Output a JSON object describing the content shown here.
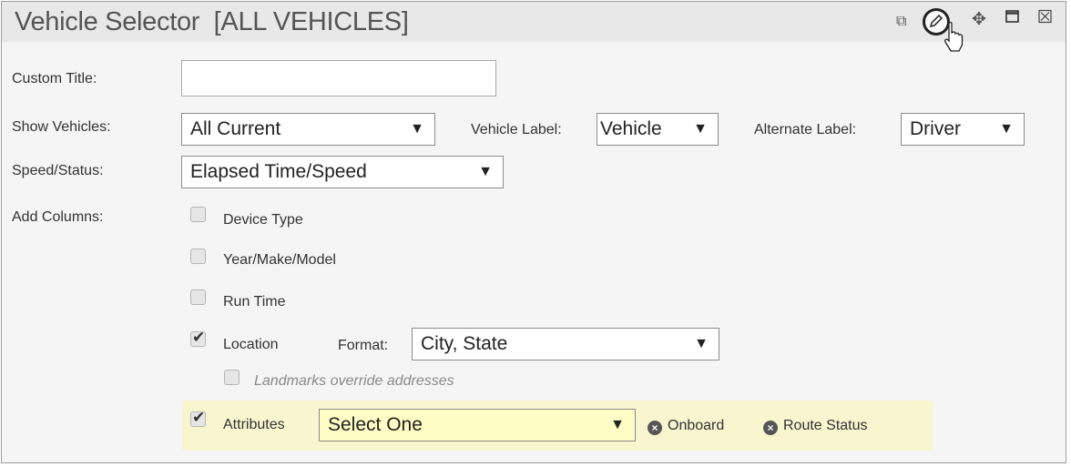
{
  "window": {
    "title": "Vehicle Selector  [ALL VEHICLES]",
    "controls": [
      "copy-icon",
      "edit-icon",
      "move-icon",
      "maximize-icon",
      "close-icon"
    ]
  },
  "form": {
    "custom_title": {
      "label": "Custom Title:",
      "value": ""
    },
    "show_vehicles": {
      "label": "Show Vehicles:",
      "value": "All Current"
    },
    "vehicle_label": {
      "label": "Vehicle Label:",
      "value": "Vehicle"
    },
    "alternate_label": {
      "label": "Alternate Label:",
      "value": "Driver"
    },
    "speed_status": {
      "label": "Speed/Status:",
      "value": "Elapsed Time/Speed"
    },
    "add_columns": {
      "label": "Add Columns:",
      "device_type": {
        "label": "Device Type",
        "checked": false
      },
      "year_make_model": {
        "label": "Year/Make/Model",
        "checked": false
      },
      "run_time": {
        "label": "Run Time",
        "checked": false
      },
      "location": {
        "label": "Location",
        "checked": true,
        "format_label": "Format:",
        "format_value": "City, State"
      },
      "landmarks": {
        "label": "Landmarks override addresses",
        "checked": false
      },
      "attributes": {
        "label": "Attributes",
        "checked": true,
        "select_value": "Select One",
        "chips": [
          "Onboard",
          "Route Status"
        ]
      }
    }
  },
  "colors": {
    "attribute_highlight": "#f7f6cf",
    "title_bar": "#e8e8e8",
    "panel_bg": "#f5f5f5"
  }
}
